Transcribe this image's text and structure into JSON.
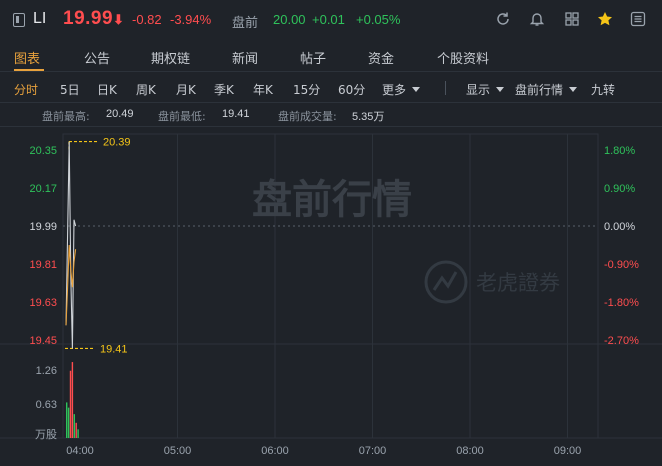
{
  "header": {
    "symbol": "LI",
    "price": "19.99",
    "price_arrow": "⬇",
    "change": "-0.82",
    "change_pct": "-3.94%",
    "premarket_label": "盘前",
    "premarket_price": "20.00",
    "premarket_change": "+0.01",
    "premarket_change_pct": "+0.05%",
    "icons": [
      "refresh-icon",
      "bell-icon",
      "grid-icon",
      "star-icon",
      "menu-icon"
    ],
    "star_color": "#f5c518"
  },
  "tabs": [
    "图表",
    "公告",
    "期权链",
    "新闻",
    "帖子",
    "资金",
    "个股资料"
  ],
  "active_tab": "图表",
  "periods": {
    "items": [
      "分时",
      "5日",
      "日K",
      "周K",
      "月K",
      "季K",
      "年K",
      "15分",
      "60分",
      "更多"
    ],
    "active": "分时",
    "right_items": [
      "显示",
      "盘前行情",
      "九转"
    ]
  },
  "stats": {
    "high_label": "盘前最高:",
    "high_value": "20.49",
    "low_label": "盘前最低:",
    "low_value": "19.41",
    "vol_label": "盘前成交量:",
    "vol_value": "5.35万"
  },
  "chart_data": {
    "type": "line",
    "watermark": "盘前行情",
    "brand_watermark": "老虎證券",
    "price_axis": {
      "ticks": [
        {
          "label": "20.35",
          "value": 20.35,
          "color": "#2fc25b"
        },
        {
          "label": "20.17",
          "value": 20.17,
          "color": "#2fc25b"
        },
        {
          "label": "19.99",
          "value": 19.99,
          "color": "#d0d4da"
        },
        {
          "label": "19.81",
          "value": 19.81,
          "color": "#ff4d4f"
        },
        {
          "label": "19.63",
          "value": 19.63,
          "color": "#ff4d4f"
        },
        {
          "label": "19.45",
          "value": 19.45,
          "color": "#ff4d4f"
        }
      ],
      "ylim": [
        19.45,
        20.35
      ]
    },
    "pct_axis": {
      "ticks": [
        {
          "label": "1.80%",
          "color": "#2fc25b"
        },
        {
          "label": "0.90%",
          "color": "#2fc25b"
        },
        {
          "label": "0.00%",
          "color": "#d0d4da"
        },
        {
          "label": "-0.90%",
          "color": "#ff4d4f"
        },
        {
          "label": "-1.80%",
          "color": "#ff4d4f"
        },
        {
          "label": "-2.70%",
          "color": "#ff4d4f"
        }
      ]
    },
    "x_ticks": [
      "04:00",
      "05:00",
      "06:00",
      "07:00",
      "08:00",
      "09:00"
    ],
    "high_marker": {
      "label": "20.39",
      "value": 20.39
    },
    "low_marker": {
      "label": "19.41",
      "value": 19.41
    },
    "series": [
      {
        "values": [
          19.52,
          19.95,
          20.39,
          19.75,
          19.41,
          20.02,
          19.99
        ],
        "color": "#cfd3d8"
      },
      {
        "values": [
          19.52,
          19.7,
          19.9,
          19.78,
          19.7,
          19.82,
          19.88
        ],
        "color": "#e8a23d"
      }
    ],
    "volume": {
      "ticks": [
        "1.26",
        "0.63",
        "万股"
      ],
      "ylim": [
        0,
        1.89
      ],
      "bars": [
        {
          "value": 0.82,
          "color": "#2fc25b"
        },
        {
          "value": 0.7,
          "color": "#2fc25b"
        },
        {
          "value": 1.55,
          "color": "#ff4d4f"
        },
        {
          "value": 1.75,
          "color": "#ff4d4f"
        },
        {
          "value": 0.55,
          "color": "#2fc25b"
        },
        {
          "value": 0.35,
          "color": "#ff4d4f"
        },
        {
          "value": 0.2,
          "color": "#2fc25b"
        }
      ]
    }
  }
}
